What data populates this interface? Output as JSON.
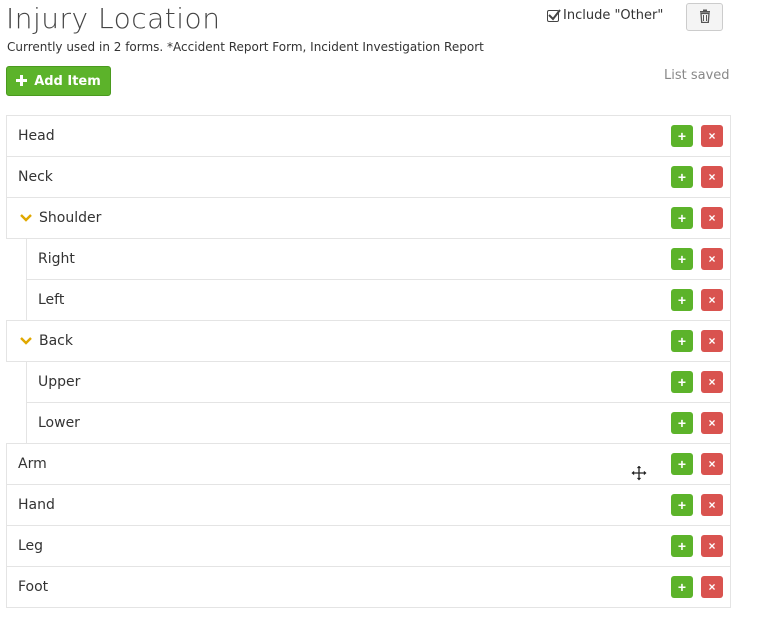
{
  "header": {
    "title": "Injury Location",
    "subtitle": "Currently used in 2 forms. *Accident Report Form, Incident Investigation Report",
    "include_other_label": "Include \"Other\"",
    "include_other_checked": true,
    "trash_icon": "trash-icon"
  },
  "toolbar": {
    "add_item_label": "Add Item",
    "status": "List saved"
  },
  "list": {
    "items": [
      {
        "label": "Head",
        "level": 0,
        "expandable": false
      },
      {
        "label": "Neck",
        "level": 0,
        "expandable": false
      },
      {
        "label": "Shoulder",
        "level": 0,
        "expandable": true,
        "expanded": true
      },
      {
        "label": "Right",
        "level": 1,
        "expandable": false
      },
      {
        "label": "Left",
        "level": 1,
        "expandable": false
      },
      {
        "label": "Back",
        "level": 0,
        "expandable": true,
        "expanded": true
      },
      {
        "label": "Upper",
        "level": 1,
        "expandable": false
      },
      {
        "label": "Lower",
        "level": 1,
        "expandable": false
      },
      {
        "label": "Arm",
        "level": 0,
        "expandable": false
      },
      {
        "label": "Hand",
        "level": 0,
        "expandable": false
      },
      {
        "label": "Leg",
        "level": 0,
        "expandable": false
      },
      {
        "label": "Foot",
        "level": 0,
        "expandable": false
      }
    ],
    "add_symbol": "+",
    "delete_symbol": "×"
  },
  "colors": {
    "green": "#5cb32a",
    "red": "#d9534f",
    "chevron": "#e0a800"
  }
}
